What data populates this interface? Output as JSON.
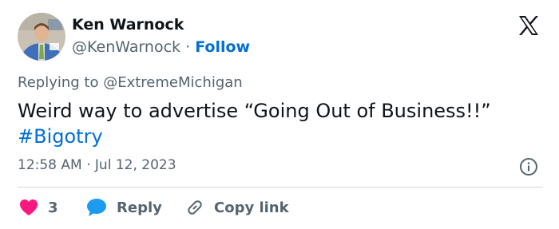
{
  "author": {
    "name": "Ken Warnock",
    "handle": "@KenWarnock",
    "separator": "·",
    "follow_label": "Follow"
  },
  "reply_context": {
    "prefix": "Replying to",
    "mention": "@ExtremeMichigan"
  },
  "tweet": {
    "text": "Weird way to advertise “Going Out of Business!!”",
    "hashtag": "#Bigotry"
  },
  "meta": {
    "time": "12:58 AM",
    "separator": "·",
    "date": "Jul 12, 2023"
  },
  "actions": {
    "like_count": "3",
    "reply_label": "Reply",
    "copy_label": "Copy link"
  },
  "icons": {
    "logo": "x-logo-icon",
    "info": "info-icon",
    "like": "heart-icon",
    "reply": "speech-bubble-icon",
    "copy": "link-icon"
  },
  "colors": {
    "accent": "#006fd6",
    "like": "#f91880",
    "reply": "#1d9bf0",
    "muted": "#536471",
    "text": "#0f1419",
    "divider": "#cfd9de"
  }
}
